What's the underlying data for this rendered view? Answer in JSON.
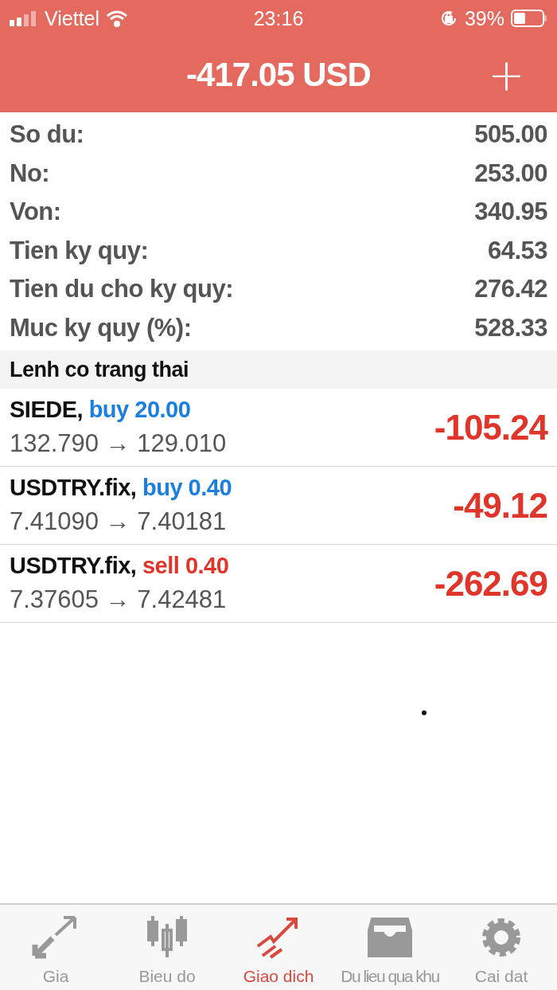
{
  "status_bar": {
    "carrier": "Viettel",
    "time": "23:16",
    "battery": "39%"
  },
  "header": {
    "title": "-417.05 USD",
    "add": "+"
  },
  "summary": [
    {
      "label": "So du:",
      "value": "505.00"
    },
    {
      "label": "No:",
      "value": "253.00"
    },
    {
      "label": "Von:",
      "value": "340.95"
    },
    {
      "label": "Tien ky quy:",
      "value": "64.53"
    },
    {
      "label": "Tien du cho ky quy:",
      "value": "276.42"
    },
    {
      "label": "Muc ky quy (%):",
      "value": "528.33"
    }
  ],
  "section_title": "Lenh co trang thai",
  "orders": [
    {
      "symbol": "SIEDE,",
      "kind": "buy",
      "action": "buy 20.00",
      "prices": "132.790 → 129.010",
      "profit": "-105.24"
    },
    {
      "symbol": "USDTRY.fix,",
      "kind": "buy",
      "action": "buy 0.40",
      "prices": "7.41090 → 7.40181",
      "profit": "-49.12"
    },
    {
      "symbol": "USDTRY.fix,",
      "kind": "sell",
      "action": "sell 0.40",
      "prices": "7.37605 → 7.42481",
      "profit": "-262.69"
    }
  ],
  "tabs": [
    {
      "label": "Gia",
      "selected": false
    },
    {
      "label": "Bieu do",
      "selected": false
    },
    {
      "label": "Giao dich",
      "selected": true
    },
    {
      "label": "Du lieu qua khu",
      "selected": false
    },
    {
      "label": "Cai dat",
      "selected": false
    }
  ]
}
